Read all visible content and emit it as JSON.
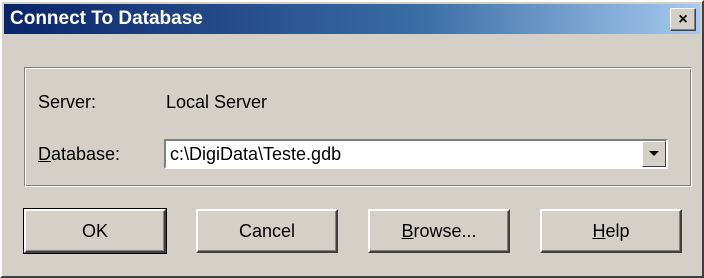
{
  "window": {
    "title": "Connect To Database",
    "close_glyph": "×"
  },
  "group": {
    "server_label": "Server:",
    "server_value": "Local Server",
    "database_label_mnemonic": "D",
    "database_label_rest": "atabase:",
    "database_value": "c:\\DigiData\\Teste.gdb"
  },
  "buttons": {
    "ok": "OK",
    "cancel": "Cancel",
    "browse_mnemonic": "B",
    "browse_rest": "rowse...",
    "help_mnemonic": "H",
    "help_rest": "elp"
  },
  "icons": {
    "close": "close-icon",
    "dropdown": "chevron-down-icon"
  },
  "colors": {
    "titlebar_start": "#0a246a",
    "titlebar_end": "#a6caf0",
    "face": "#d4d0c8"
  }
}
